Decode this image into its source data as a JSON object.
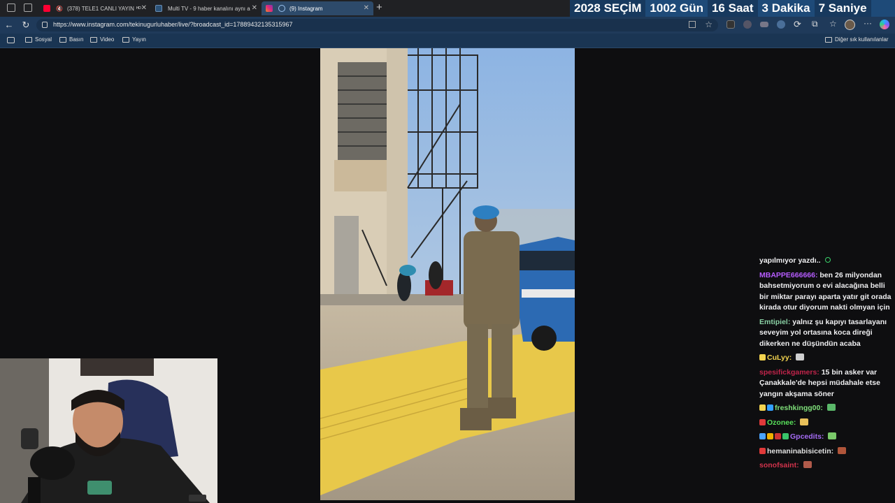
{
  "tabs": [
    {
      "title": "(378) TELE1 CANLI YAYIN",
      "live_badge": "ᴴᴰ",
      "icon": "youtube-icon",
      "color": "#ff0033"
    },
    {
      "title": "Multi TV - 9 haber kanalını aynı a",
      "icon": "multitv-icon",
      "color": "#2b5278"
    },
    {
      "title": "(9) Instagram",
      "icon": "instagram-icon",
      "color": "#e1306c"
    }
  ],
  "countdown": {
    "year": "2028",
    "label": "SEÇİM",
    "days": "1002",
    "days_unit": "Gün",
    "hours": "16",
    "hours_unit": "Saat",
    "minutes": "3",
    "minutes_unit": "Dakika",
    "seconds": "7",
    "seconds_unit": "Saniye"
  },
  "address": {
    "url": "https://www.instagram.com/tekinugurluhaber/live/?broadcast_id=17889432135315967"
  },
  "bookmarks": {
    "items": [
      "Sosyal",
      "Basın",
      "Video",
      "Yayın"
    ],
    "other": "Diğer sık kullanılanlar"
  },
  "chat": {
    "messages": [
      {
        "user": "",
        "text": "yapılmıyor yazdı..",
        "user_color": "#efeff1"
      },
      {
        "user": "MBAPPE666666:",
        "text": "ben 26 milyondan bahsetmiyorum o evi alacağına belli bir miktar parayı aparta yatır git orada kirada otur diyorum nakti olmyan için",
        "user_color": "#b65cff"
      },
      {
        "user": "Emtipiel:",
        "text": "yalnız şu kapıyı tasarlayanı seveyim yol ortasına koca direği dikerken ne düşündün acaba",
        "user_color": "#8ad1a5"
      },
      {
        "user": "CuLyy:",
        "text": "",
        "user_color": "#f2d34f"
      },
      {
        "user": "spesifickgamers:",
        "text": "15 bin asker var Çanakkale'de hepsi müdahale etse yangın akşama söner",
        "user_color": "#c0244a"
      },
      {
        "user": "freshkingg00:",
        "text": "",
        "user_color": "#7fe07a"
      },
      {
        "user": "Ozonee:",
        "text": "",
        "user_color": "#58e05a"
      },
      {
        "user": "Gpcedits:",
        "text": "",
        "user_color": "#a56cf5"
      },
      {
        "user": "hemaninabisicetin:",
        "text": "",
        "user_color": "#e0e0e0"
      },
      {
        "user": "sonofsaint:",
        "text": "",
        "user_color": "#d2334c"
      }
    ]
  }
}
